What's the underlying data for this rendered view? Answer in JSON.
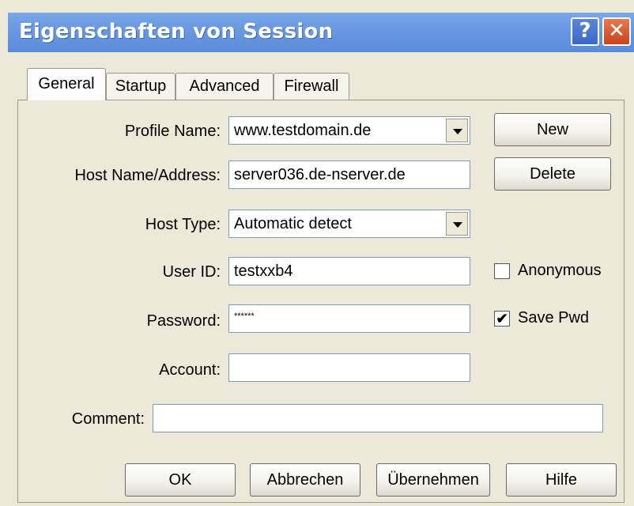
{
  "window": {
    "title": "Eigenschaften von Session",
    "help_glyph": "?",
    "close_glyph": "✕",
    "accent": "#6b9be2",
    "close_color": "#c8441c"
  },
  "tabs": [
    {
      "label": "General",
      "active": true
    },
    {
      "label": "Startup",
      "active": false
    },
    {
      "label": "Advanced",
      "active": false
    },
    {
      "label": "Firewall",
      "active": false
    }
  ],
  "form": {
    "profile_name": {
      "label": "Profile Name:",
      "value": "www.testdomain.de"
    },
    "host_name": {
      "label": "Host Name/Address:",
      "value": "server036.de-nserver.de"
    },
    "host_type": {
      "label": "Host Type:",
      "value": "Automatic detect"
    },
    "user_id": {
      "label": "User ID:",
      "value": "testxxb4"
    },
    "password": {
      "label": "Password:",
      "value": "******"
    },
    "account": {
      "label": "Account:",
      "value": ""
    },
    "comment": {
      "label": "Comment:",
      "value": ""
    },
    "anonymous": {
      "label": "Anonymous",
      "checked": false
    },
    "save_pwd": {
      "label": "Save Pwd",
      "checked": true,
      "mark": "✔"
    }
  },
  "side_buttons": {
    "new": "New",
    "delete": "Delete"
  },
  "footer": {
    "ok": "OK",
    "cancel": "Abbrechen",
    "apply": "Übernehmen",
    "help": "Hilfe"
  }
}
